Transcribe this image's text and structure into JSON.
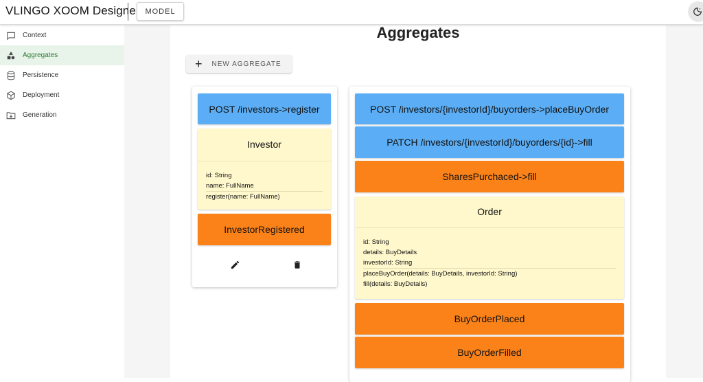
{
  "app": {
    "title": "VLINGO XOOM Designer",
    "model_label": "MODEL"
  },
  "sidebar": {
    "items": [
      {
        "label": "Context",
        "icon": "comment-icon",
        "active": false
      },
      {
        "label": "Aggregates",
        "icon": "shapes-icon",
        "active": true
      },
      {
        "label": "Persistence",
        "icon": "database-icon",
        "active": false
      },
      {
        "label": "Deployment",
        "icon": "cube-icon",
        "active": false
      },
      {
        "label": "Generation",
        "icon": "folder-download-icon",
        "active": false
      }
    ]
  },
  "main": {
    "title": "Aggregates",
    "new_aggregate_label": "NEW AGGREGATE"
  },
  "aggregates": [
    {
      "routes": [
        "POST /investors->register"
      ],
      "name": "Investor",
      "fields": [
        "id: String",
        "name: FullName"
      ],
      "methods": [
        "register(name: FullName)"
      ],
      "events": [
        "InvestorRegistered"
      ]
    },
    {
      "routes": [
        "POST /investors/{investorId}/buyorders->placeBuyOrder",
        "PATCH /investors/{investorId}/buyorders/{id}->fill"
      ],
      "external_events": [
        "SharesPurchaced->fill"
      ],
      "name": "Order",
      "fields": [
        "id: String",
        "details: BuyDetails",
        "investorId: String"
      ],
      "methods": [
        "placeBuyOrder(details: BuyDetails, investorId: String)",
        "fill(details: BuyDetails)"
      ],
      "events": [
        "BuyOrderPlaced",
        "BuyOrderFilled"
      ]
    }
  ],
  "colors": {
    "route": "#5baef5",
    "event": "#fb8219",
    "aggregate": "#fff8cc",
    "active_nav": "#2e7d32"
  }
}
